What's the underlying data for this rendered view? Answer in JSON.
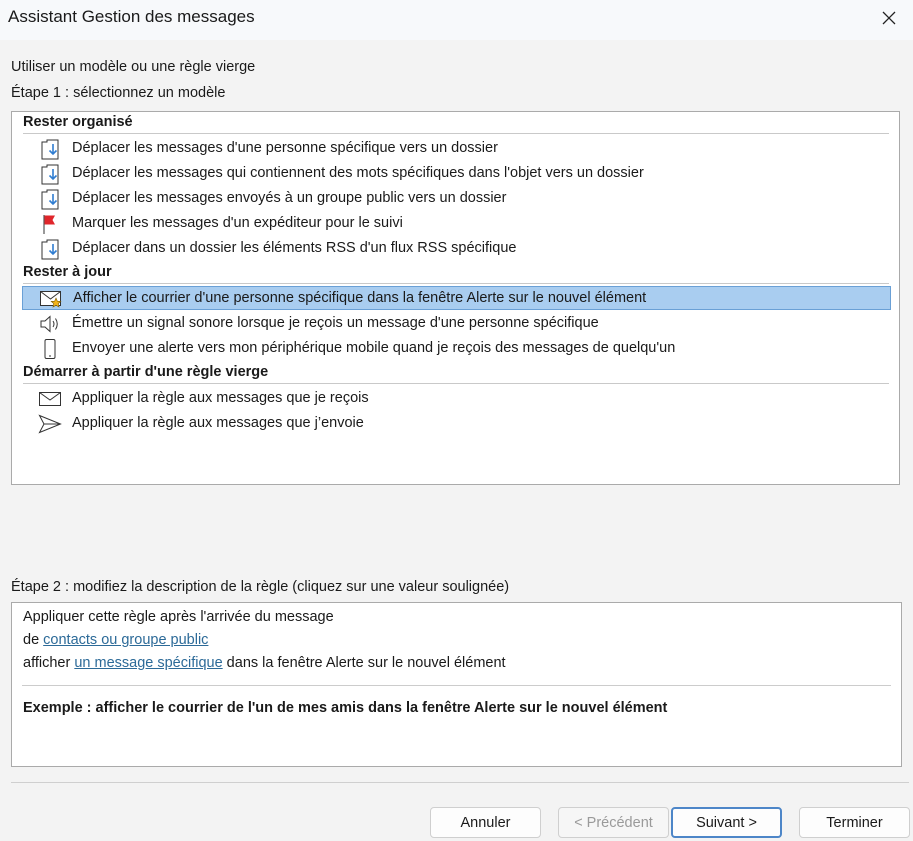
{
  "window": {
    "title": "Assistant Gestion des messages"
  },
  "labels": {
    "template_heading": "Utiliser un modèle ou une règle vierge",
    "step1": "Étape 1 : sélectionnez un modèle",
    "step2": "Étape 2 : modifiez la description de la règle (cliquez sur une valeur soulignée)"
  },
  "groups": [
    {
      "label": "Rester organisé"
    },
    {
      "label": "Rester à jour"
    },
    {
      "label": "Démarrer à partir d'une règle vierge"
    }
  ],
  "templates": [
    {
      "label": "Déplacer les messages d'une personne spécifique vers un dossier",
      "icon": "move-to-folder-icon"
    },
    {
      "label": "Déplacer les messages qui contiennent des mots spécifiques dans l'objet vers un dossier",
      "icon": "move-to-folder-icon"
    },
    {
      "label": "Déplacer les messages envoyés à un groupe public vers un dossier",
      "icon": "move-to-folder-icon"
    },
    {
      "label": "Marquer les messages d'un expéditeur pour le suivi",
      "icon": "red-flag-icon"
    },
    {
      "label": "Déplacer dans un dossier les éléments RSS d'un flux RSS spécifique",
      "icon": "move-to-folder-icon"
    },
    {
      "label": "Afficher le courrier d'une personne spécifique dans la fenêtre Alerte sur le nouvel élément",
      "icon": "mail-star-icon",
      "selected": true
    },
    {
      "label": "Émettre un signal sonore lorsque je reçois un message d'une personne spécifique",
      "icon": "speaker-icon"
    },
    {
      "label": "Envoyer une alerte vers mon périphérique mobile quand je reçois des messages de quelqu'un",
      "icon": "mobile-device-icon"
    },
    {
      "label": "Appliquer la règle aux messages que je reçois",
      "icon": "envelope-icon"
    },
    {
      "label": "Appliquer la règle aux messages que j’envoie",
      "icon": "send-icon"
    }
  ],
  "description": {
    "line1": "Appliquer cette règle après l'arrivée du message",
    "line2_prefix": "de ",
    "line2_link": "contacts ou groupe public",
    "line3_prefix": "afficher ",
    "line3_link": "un message spécifique",
    "line3_suffix": " dans la fenêtre Alerte sur le nouvel élément",
    "example": "Exemple : afficher le courrier de l'un de mes amis dans la fenêtre Alerte sur le nouvel élément"
  },
  "buttons": {
    "cancel": "Annuler",
    "previous": "< Précédent",
    "next": "Suivant >",
    "finish": "Terminer"
  },
  "colors": {
    "selection": "#a9cdf0",
    "link": "#2c6a98",
    "flag": "#e0262b",
    "accent": "#2f7dd1"
  }
}
